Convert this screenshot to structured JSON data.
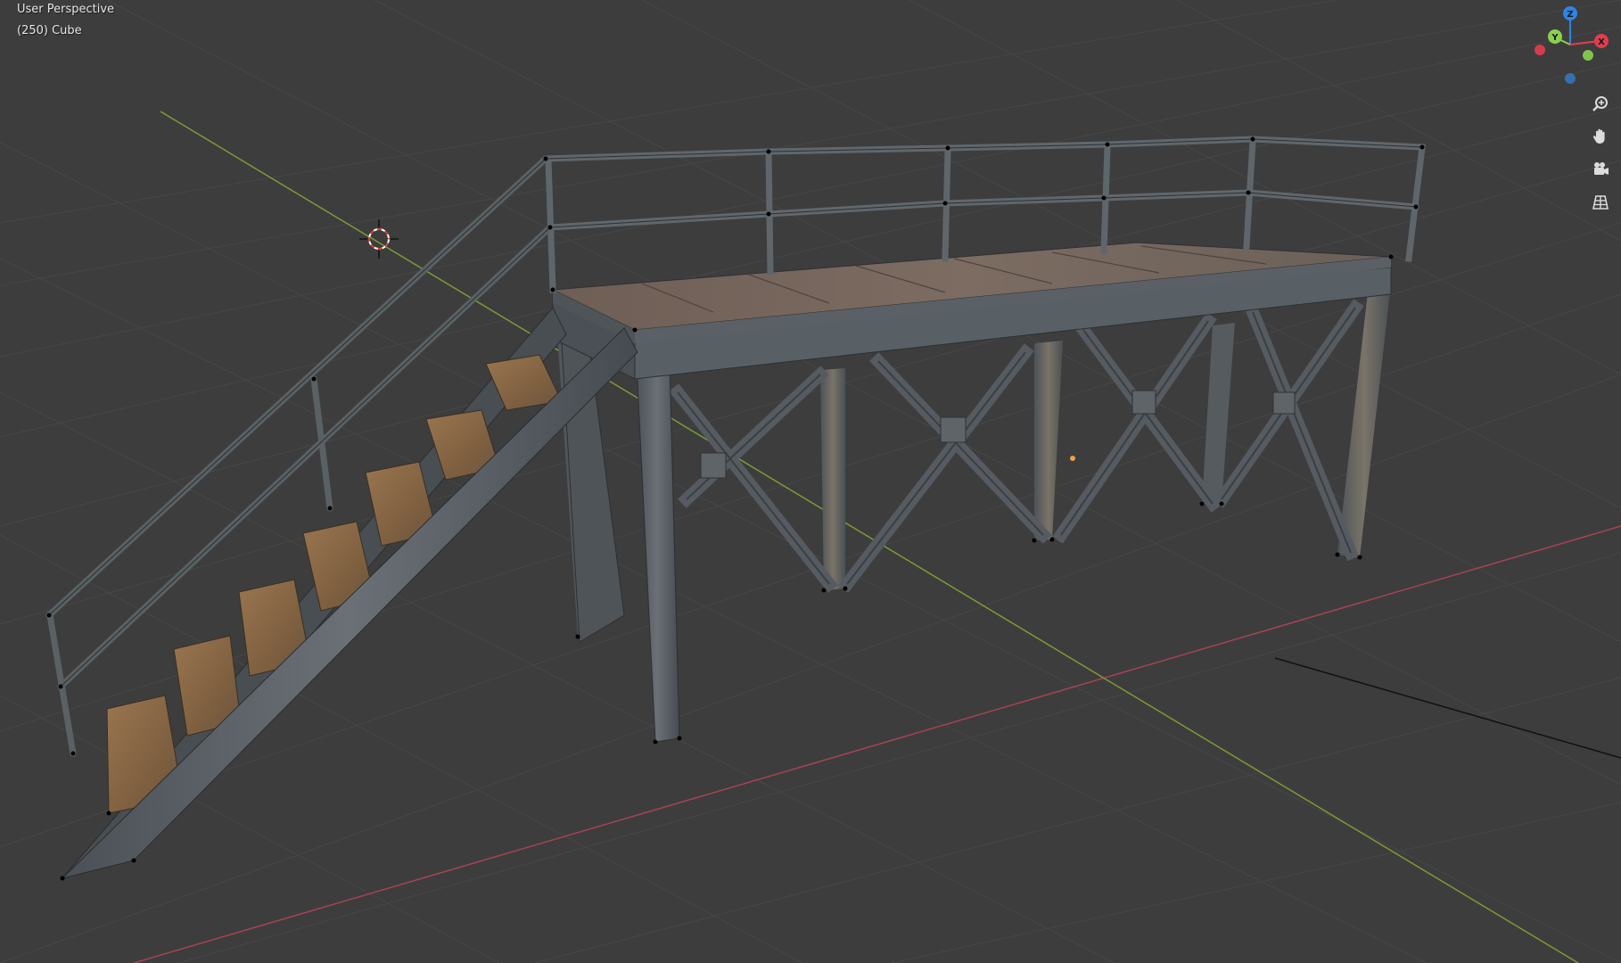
{
  "viewport": {
    "view_name": "User Perspective",
    "object_info": "(250) Cube"
  },
  "gizmo": {
    "axes": [
      {
        "name": "Z",
        "color": "#2f84e3"
      },
      {
        "name": "Y",
        "color": "#8bd14f"
      },
      {
        "name": "X",
        "color": "#e33c4f"
      }
    ]
  },
  "navigation": [
    {
      "id": "zoom",
      "icon": "zoom-icon"
    },
    {
      "id": "pan",
      "icon": "pan-hand-icon"
    },
    {
      "id": "camera",
      "icon": "camera-icon"
    },
    {
      "id": "ortho",
      "icon": "orthographic-grid-icon"
    }
  ],
  "colors": {
    "background": "#3d3d3d",
    "grid": "#474747",
    "x_axis": "#a64450",
    "y_axis": "#7c9a3a",
    "metal": "#5b6166",
    "rust": "#8a6a48",
    "cursor": "#d9432f"
  }
}
